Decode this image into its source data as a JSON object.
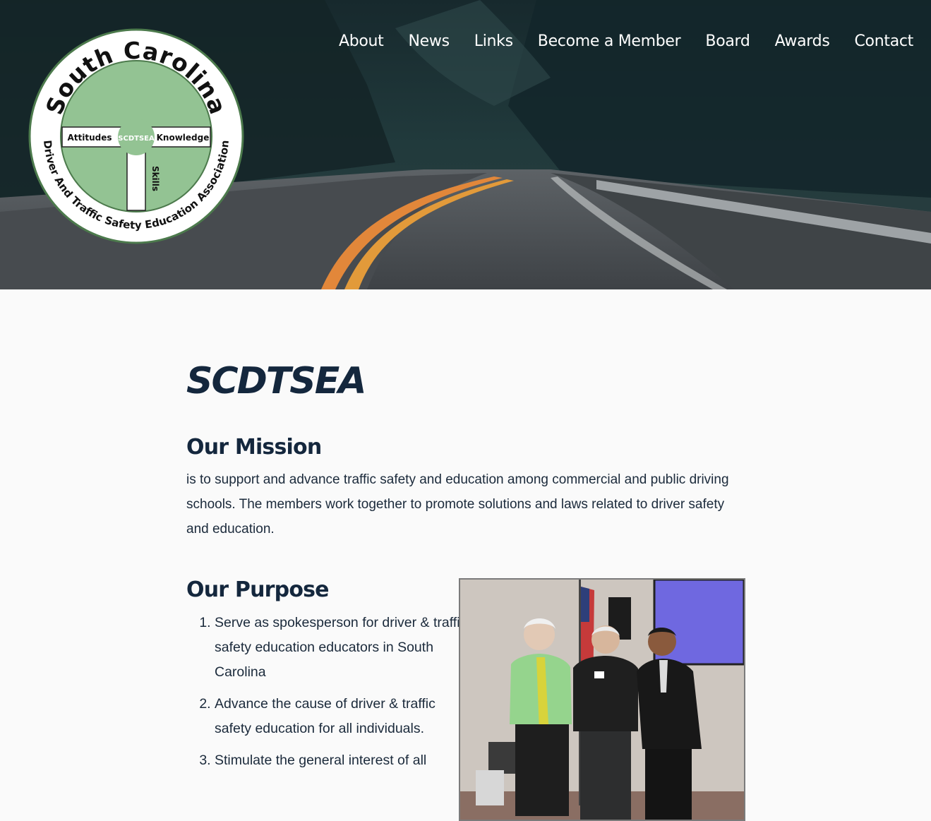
{
  "header": {
    "logo": {
      "arc_top": "South Carolina",
      "arc_bottom": "Driver And Traffic Safety Education Association",
      "left_label": "Attitudes",
      "center_label": "SCDTSEA",
      "right_label": "Knowledge",
      "vertical_label": "Skills"
    },
    "nav": [
      "About",
      "News",
      "Links",
      "Become a Member",
      "Board",
      "Awards",
      "Contact"
    ]
  },
  "main": {
    "title": "SCDTSEA",
    "mission": {
      "heading": "Our Mission",
      "text": "is to support and advance traffic safety and education among commercial and public driving schools. The members work together to promote solutions and laws related to driver safety and education."
    },
    "purpose": {
      "heading": "Our Purpose",
      "items": [
        "Serve as spokesperson for driver & traffic safety education educators in South Carolina",
        "Advance the cause of driver & traffic safety education for all individuals.",
        "Stimulate the general interest of all"
      ]
    }
  },
  "colors": {
    "heading": "#14273d",
    "body_text": "#1b2a3b",
    "logo_green": "#93c393",
    "logo_ring": "#4c7a4c",
    "road_line": "#e2873a"
  }
}
